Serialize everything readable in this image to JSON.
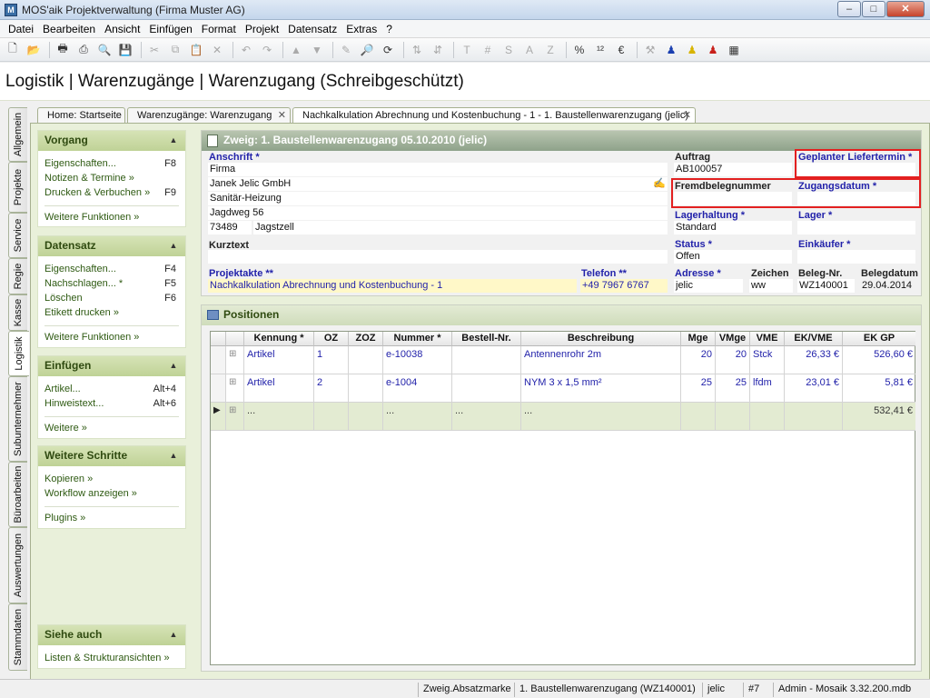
{
  "window": {
    "title": "MOS'aik Projektverwaltung (Firma Muster AG)",
    "btn_min": "‒",
    "btn_max": "□",
    "btn_close": "✕"
  },
  "menu": [
    "Datei",
    "Bearbeiten",
    "Ansicht",
    "Einfügen",
    "Format",
    "Projekt",
    "Datensatz",
    "Extras",
    "?"
  ],
  "page_title": "Logistik | Warenzugänge | Warenzugang (Schreibgeschützt)",
  "vertical_tabs": [
    "Allgemein",
    "Projekte",
    "Service",
    "Regie",
    "Kasse",
    "Logistik",
    "Subunternehmer",
    "Büroarbeiten",
    "Auswertungen",
    "Stammdaten"
  ],
  "doc_tabs": [
    {
      "label": "Home: Startseite"
    },
    {
      "label": "Warenzugänge: Warenzugang"
    },
    {
      "label": "Nachkalkulation Abrechnung und Kostenbuchung - 1 - 1. Baustellenwarenzugang (jelic)"
    }
  ],
  "left_panels": {
    "vorgang": {
      "title": "Vorgang",
      "items": [
        {
          "label": "Eigenschaften...",
          "key": "F8"
        },
        {
          "label": "Notizen & Termine »",
          "key": ""
        },
        {
          "label": "Drucken & Verbuchen »",
          "key": "F9"
        }
      ],
      "more": "Weitere Funktionen »"
    },
    "datensatz": {
      "title": "Datensatz",
      "items": [
        {
          "label": "Eigenschaften...",
          "key": "F4"
        },
        {
          "label": "Nachschlagen... *",
          "key": "F5"
        },
        {
          "label": "Löschen",
          "key": "F6"
        },
        {
          "label": "Etikett drucken »",
          "key": ""
        }
      ],
      "more": "Weitere Funktionen »"
    },
    "einfuegen": {
      "title": "Einfügen",
      "items": [
        {
          "label": "Artikel...",
          "key": "Alt+4"
        },
        {
          "label": "Hinweistext...",
          "key": "Alt+6"
        }
      ],
      "more": "Weitere »"
    },
    "weitere": {
      "title": "Weitere Schritte",
      "items": [
        {
          "label": "Kopieren »",
          "key": ""
        },
        {
          "label": "Workflow anzeigen »",
          "key": ""
        }
      ],
      "more": "Plugins »"
    },
    "siehe": {
      "title": "Siehe auch",
      "items": [
        {
          "label": "Listen & Strukturansichten »",
          "key": ""
        }
      ]
    }
  },
  "form": {
    "header": "Zweig: 1. Baustellenwarenzugang 05.10.2010 (jelic)",
    "anschrift_label": "Anschrift *",
    "anschrift": [
      "Firma",
      "Janek Jelic GmbH",
      "Sanitär-Heizung",
      "Jagdweg 56"
    ],
    "plz": "73489",
    "ort": "Jagstzell",
    "kurztext_label": "Kurztext",
    "kurztext": "",
    "projektakte_label": "Projektakte **",
    "projektakte": "Nachkalkulation Abrechnung und Kostenbuchung - 1",
    "telefon_label": "Telefon **",
    "telefon": "+49 7967 6767",
    "auftrag_label": "Auftrag",
    "auftrag": "AB100057",
    "liefertermin_label": "Geplanter Liefertermin *",
    "liefertermin": "",
    "fremdbeleg_label": "Fremdbelegnummer",
    "fremdbeleg": "",
    "zugangsdatum_label": "Zugangsdatum *",
    "zugangsdatum": "",
    "lagerhaltung_label": "Lagerhaltung *",
    "lagerhaltung": "Standard",
    "lager_label": "Lager *",
    "lager": "",
    "status_label": "Status *",
    "status": "Offen",
    "einkaeufer_label": "Einkäufer *",
    "einkaeufer": "",
    "adresse_label": "Adresse *",
    "adresse": "jelic",
    "zeichen_label": "Zeichen",
    "zeichen": "ww",
    "belegnr_label": "Beleg-Nr.",
    "belegnr": "WZ140001",
    "belegdatum_label": "Belegdatum",
    "belegdatum": "29.04.2014"
  },
  "positions": {
    "title": "Positionen",
    "columns": [
      "Kennung *",
      "OZ",
      "ZOZ",
      "Nummer *",
      "Bestell-Nr.",
      "Beschreibung",
      "Mge",
      "VMge",
      "VME",
      "EK/VME",
      "EK GP"
    ],
    "rows": [
      {
        "kennung": "Artikel",
        "oz": "1",
        "zoz": "",
        "nummer": "e-10038",
        "bestell": "",
        "beschreibung": "Antennenrohr 2m",
        "mge": "20",
        "vmge": "20",
        "vme": "Stck",
        "ekvme": "26,33 €",
        "ekgp": "526,60 €"
      },
      {
        "kennung": "Artikel",
        "oz": "2",
        "zoz": "",
        "nummer": "e-1004",
        "bestell": "",
        "beschreibung": "NYM 3 x 1,5 mm²",
        "mge": "25",
        "vmge": "25",
        "vme": "lfdm",
        "ekvme": "23,01 €",
        "ekgp": "5,81 €"
      }
    ],
    "sum_row": {
      "kennung": "...",
      "nummer": "...",
      "bestell": "...",
      "beschreibung": "...",
      "ekgp": "532,41 €"
    }
  },
  "statusbar": [
    "Zweig.Absatzmarke",
    "1. Baustellenwarenzugang (WZ140001)",
    "jelic",
    "#7",
    "Admin - Mosaik 3.32.200.mdb"
  ],
  "colors": {
    "accent_green": "#bfd296",
    "red_highlight": "#e32020",
    "link_blue": "#2222aa"
  }
}
